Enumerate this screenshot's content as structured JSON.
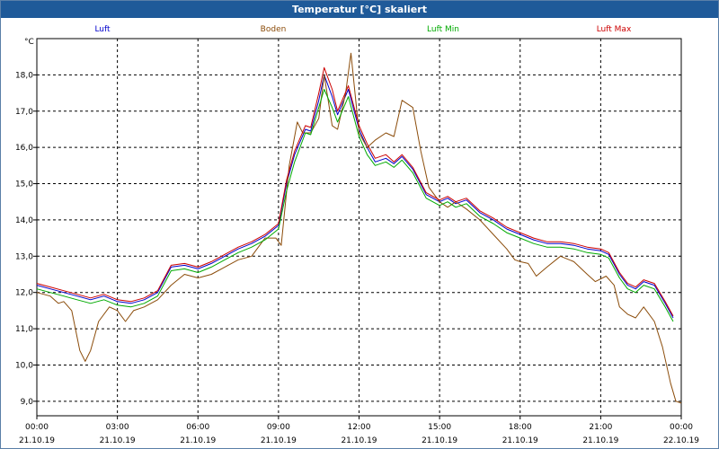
{
  "window": {
    "title": "Temperatur [°C] skaliert"
  },
  "chart_data": {
    "type": "line",
    "title": "Temperatur [°C] skaliert",
    "ylabel": "°C",
    "xlabel": "",
    "ylim": [
      8.6,
      19.0
    ],
    "xlim_hours": [
      0,
      24
    ],
    "y_ticks": [
      "9,0",
      "10,0",
      "11,0",
      "12,0",
      "13,0",
      "14,0",
      "15,0",
      "16,0",
      "17,0",
      "18,0"
    ],
    "x_ticks": [
      {
        "time": "00:00",
        "date": "21.10.19"
      },
      {
        "time": "03:00",
        "date": "21.10.19"
      },
      {
        "time": "06:00",
        "date": "21.10.19"
      },
      {
        "time": "09:00",
        "date": "21.10.19"
      },
      {
        "time": "12:00",
        "date": "21.10.19"
      },
      {
        "time": "15:00",
        "date": "21.10.19"
      },
      {
        "time": "18:00",
        "date": "21.10.19"
      },
      {
        "time": "21:00",
        "date": "21.10.19"
      },
      {
        "time": "00:00",
        "date": "22.10.19"
      }
    ],
    "grid": true,
    "legend_position": "top",
    "series": [
      {
        "name": "Luft",
        "color": "#0000cc",
        "points": [
          [
            0,
            12.2
          ],
          [
            0.5,
            12.1
          ],
          [
            1,
            12.0
          ],
          [
            1.5,
            11.9
          ],
          [
            2,
            11.8
          ],
          [
            2.5,
            11.9
          ],
          [
            3,
            11.75
          ],
          [
            3.5,
            11.7
          ],
          [
            4,
            11.8
          ],
          [
            4.5,
            12.0
          ],
          [
            5,
            12.7
          ],
          [
            5.5,
            12.75
          ],
          [
            6,
            12.65
          ],
          [
            6.5,
            12.8
          ],
          [
            7,
            13.0
          ],
          [
            7.5,
            13.2
          ],
          [
            8,
            13.35
          ],
          [
            8.5,
            13.55
          ],
          [
            9,
            13.85
          ],
          [
            9.3,
            15.0
          ],
          [
            9.6,
            15.8
          ],
          [
            10,
            16.5
          ],
          [
            10.2,
            16.45
          ],
          [
            10.5,
            17.3
          ],
          [
            10.7,
            18.0
          ],
          [
            11,
            17.4
          ],
          [
            11.2,
            16.9
          ],
          [
            11.6,
            17.6
          ],
          [
            12,
            16.5
          ],
          [
            12.3,
            16.0
          ],
          [
            12.6,
            15.6
          ],
          [
            13,
            15.7
          ],
          [
            13.3,
            15.55
          ],
          [
            13.6,
            15.75
          ],
          [
            14,
            15.4
          ],
          [
            14.5,
            14.7
          ],
          [
            15,
            14.5
          ],
          [
            15.3,
            14.6
          ],
          [
            15.6,
            14.45
          ],
          [
            16,
            14.55
          ],
          [
            16.5,
            14.2
          ],
          [
            17,
            14.0
          ],
          [
            17.5,
            13.75
          ],
          [
            18,
            13.6
          ],
          [
            18.5,
            13.45
          ],
          [
            19,
            13.35
          ],
          [
            19.5,
            13.35
          ],
          [
            20,
            13.3
          ],
          [
            20.5,
            13.2
          ],
          [
            21,
            13.15
          ],
          [
            21.3,
            13.05
          ],
          [
            21.7,
            12.5
          ],
          [
            22,
            12.2
          ],
          [
            22.3,
            12.1
          ],
          [
            22.6,
            12.3
          ],
          [
            23,
            12.2
          ],
          [
            23.4,
            11.7
          ],
          [
            23.7,
            11.3
          ]
        ]
      },
      {
        "name": "Boden",
        "color": "#8b4c0a",
        "points": [
          [
            0,
            12.0
          ],
          [
            0.5,
            11.9
          ],
          [
            0.8,
            11.7
          ],
          [
            1,
            11.75
          ],
          [
            1.3,
            11.5
          ],
          [
            1.6,
            10.4
          ],
          [
            1.8,
            10.1
          ],
          [
            2,
            10.4
          ],
          [
            2.3,
            11.2
          ],
          [
            2.7,
            11.6
          ],
          [
            3,
            11.5
          ],
          [
            3.3,
            11.2
          ],
          [
            3.6,
            11.5
          ],
          [
            4,
            11.6
          ],
          [
            4.5,
            11.8
          ],
          [
            5,
            12.2
          ],
          [
            5.5,
            12.5
          ],
          [
            6,
            12.4
          ],
          [
            6.5,
            12.5
          ],
          [
            7,
            12.7
          ],
          [
            7.5,
            12.9
          ],
          [
            8,
            13.0
          ],
          [
            8.5,
            13.5
          ],
          [
            8.9,
            13.5
          ],
          [
            9.1,
            13.3
          ],
          [
            9.4,
            15.5
          ],
          [
            9.7,
            16.7
          ],
          [
            9.9,
            16.4
          ],
          [
            10.2,
            16.4
          ],
          [
            10.5,
            16.8
          ],
          [
            10.7,
            18.0
          ],
          [
            11,
            16.6
          ],
          [
            11.2,
            16.5
          ],
          [
            11.5,
            17.5
          ],
          [
            11.7,
            18.6
          ],
          [
            12,
            16.4
          ],
          [
            12.3,
            16.0
          ],
          [
            12.6,
            16.2
          ],
          [
            13,
            16.4
          ],
          [
            13.3,
            16.3
          ],
          [
            13.6,
            17.3
          ],
          [
            14,
            17.1
          ],
          [
            14.3,
            15.9
          ],
          [
            14.6,
            14.9
          ],
          [
            15,
            14.5
          ],
          [
            15.3,
            14.35
          ],
          [
            15.6,
            14.5
          ],
          [
            16,
            14.3
          ],
          [
            16.5,
            14.0
          ],
          [
            17,
            13.6
          ],
          [
            17.5,
            13.2
          ],
          [
            17.8,
            12.9
          ],
          [
            18,
            12.85
          ],
          [
            18.3,
            12.8
          ],
          [
            18.6,
            12.45
          ],
          [
            19,
            12.7
          ],
          [
            19.5,
            13.0
          ],
          [
            20,
            12.85
          ],
          [
            20.5,
            12.5
          ],
          [
            20.8,
            12.3
          ],
          [
            21.2,
            12.45
          ],
          [
            21.5,
            12.2
          ],
          [
            21.7,
            11.6
          ],
          [
            22,
            11.4
          ],
          [
            22.3,
            11.3
          ],
          [
            22.6,
            11.6
          ],
          [
            23,
            11.2
          ],
          [
            23.3,
            10.5
          ],
          [
            23.6,
            9.5
          ],
          [
            23.8,
            9.0
          ],
          [
            24,
            8.95
          ]
        ]
      },
      {
        "name": "Luft Min",
        "color": "#00aa00",
        "points": [
          [
            0,
            12.1
          ],
          [
            0.5,
            12.0
          ],
          [
            1,
            11.9
          ],
          [
            1.5,
            11.8
          ],
          [
            2,
            11.7
          ],
          [
            2.5,
            11.8
          ],
          [
            3,
            11.65
          ],
          [
            3.5,
            11.6
          ],
          [
            4,
            11.7
          ],
          [
            4.5,
            11.9
          ],
          [
            5,
            12.6
          ],
          [
            5.5,
            12.65
          ],
          [
            6,
            12.55
          ],
          [
            6.5,
            12.7
          ],
          [
            7,
            12.9
          ],
          [
            7.5,
            13.1
          ],
          [
            8,
            13.25
          ],
          [
            8.5,
            13.45
          ],
          [
            9,
            13.75
          ],
          [
            9.3,
            14.8
          ],
          [
            9.6,
            15.6
          ],
          [
            10,
            16.4
          ],
          [
            10.2,
            16.35
          ],
          [
            10.5,
            17.1
          ],
          [
            10.7,
            17.6
          ],
          [
            11,
            17.1
          ],
          [
            11.2,
            16.7
          ],
          [
            11.6,
            17.4
          ],
          [
            12,
            16.3
          ],
          [
            12.3,
            15.8
          ],
          [
            12.6,
            15.5
          ],
          [
            13,
            15.6
          ],
          [
            13.3,
            15.45
          ],
          [
            13.6,
            15.65
          ],
          [
            14,
            15.3
          ],
          [
            14.5,
            14.6
          ],
          [
            15,
            14.4
          ],
          [
            15.3,
            14.5
          ],
          [
            15.6,
            14.35
          ],
          [
            16,
            14.45
          ],
          [
            16.5,
            14.1
          ],
          [
            17,
            13.9
          ],
          [
            17.5,
            13.65
          ],
          [
            18,
            13.5
          ],
          [
            18.5,
            13.35
          ],
          [
            19,
            13.25
          ],
          [
            19.5,
            13.25
          ],
          [
            20,
            13.2
          ],
          [
            20.5,
            13.1
          ],
          [
            21,
            13.05
          ],
          [
            21.3,
            12.95
          ],
          [
            21.7,
            12.4
          ],
          [
            22,
            12.1
          ],
          [
            22.3,
            12.0
          ],
          [
            22.6,
            12.2
          ],
          [
            23,
            12.1
          ],
          [
            23.4,
            11.6
          ],
          [
            23.7,
            11.2
          ]
        ]
      },
      {
        "name": "Luft Max",
        "color": "#cc0000",
        "points": [
          [
            0,
            12.25
          ],
          [
            0.5,
            12.15
          ],
          [
            1,
            12.05
          ],
          [
            1.5,
            11.95
          ],
          [
            2,
            11.85
          ],
          [
            2.5,
            11.95
          ],
          [
            3,
            11.8
          ],
          [
            3.5,
            11.75
          ],
          [
            4,
            11.85
          ],
          [
            4.5,
            12.05
          ],
          [
            5,
            12.75
          ],
          [
            5.5,
            12.8
          ],
          [
            6,
            12.7
          ],
          [
            6.5,
            12.85
          ],
          [
            7,
            13.05
          ],
          [
            7.5,
            13.25
          ],
          [
            8,
            13.4
          ],
          [
            8.5,
            13.6
          ],
          [
            9,
            13.9
          ],
          [
            9.3,
            15.1
          ],
          [
            9.6,
            15.9
          ],
          [
            10,
            16.6
          ],
          [
            10.2,
            16.55
          ],
          [
            10.5,
            17.5
          ],
          [
            10.7,
            18.2
          ],
          [
            11,
            17.6
          ],
          [
            11.2,
            17.0
          ],
          [
            11.6,
            17.7
          ],
          [
            12,
            16.6
          ],
          [
            12.3,
            16.1
          ],
          [
            12.6,
            15.7
          ],
          [
            13,
            15.8
          ],
          [
            13.3,
            15.6
          ],
          [
            13.6,
            15.8
          ],
          [
            14,
            15.45
          ],
          [
            14.5,
            14.75
          ],
          [
            15,
            14.55
          ],
          [
            15.3,
            14.65
          ],
          [
            15.6,
            14.5
          ],
          [
            16,
            14.6
          ],
          [
            16.5,
            14.25
          ],
          [
            17,
            14.05
          ],
          [
            17.5,
            13.8
          ],
          [
            18,
            13.65
          ],
          [
            18.5,
            13.5
          ],
          [
            19,
            13.4
          ],
          [
            19.5,
            13.4
          ],
          [
            20,
            13.35
          ],
          [
            20.5,
            13.25
          ],
          [
            21,
            13.2
          ],
          [
            21.3,
            13.1
          ],
          [
            21.7,
            12.55
          ],
          [
            22,
            12.25
          ],
          [
            22.3,
            12.15
          ],
          [
            22.6,
            12.35
          ],
          [
            23,
            12.25
          ],
          [
            23.4,
            11.75
          ],
          [
            23.7,
            11.35
          ]
        ]
      }
    ]
  }
}
